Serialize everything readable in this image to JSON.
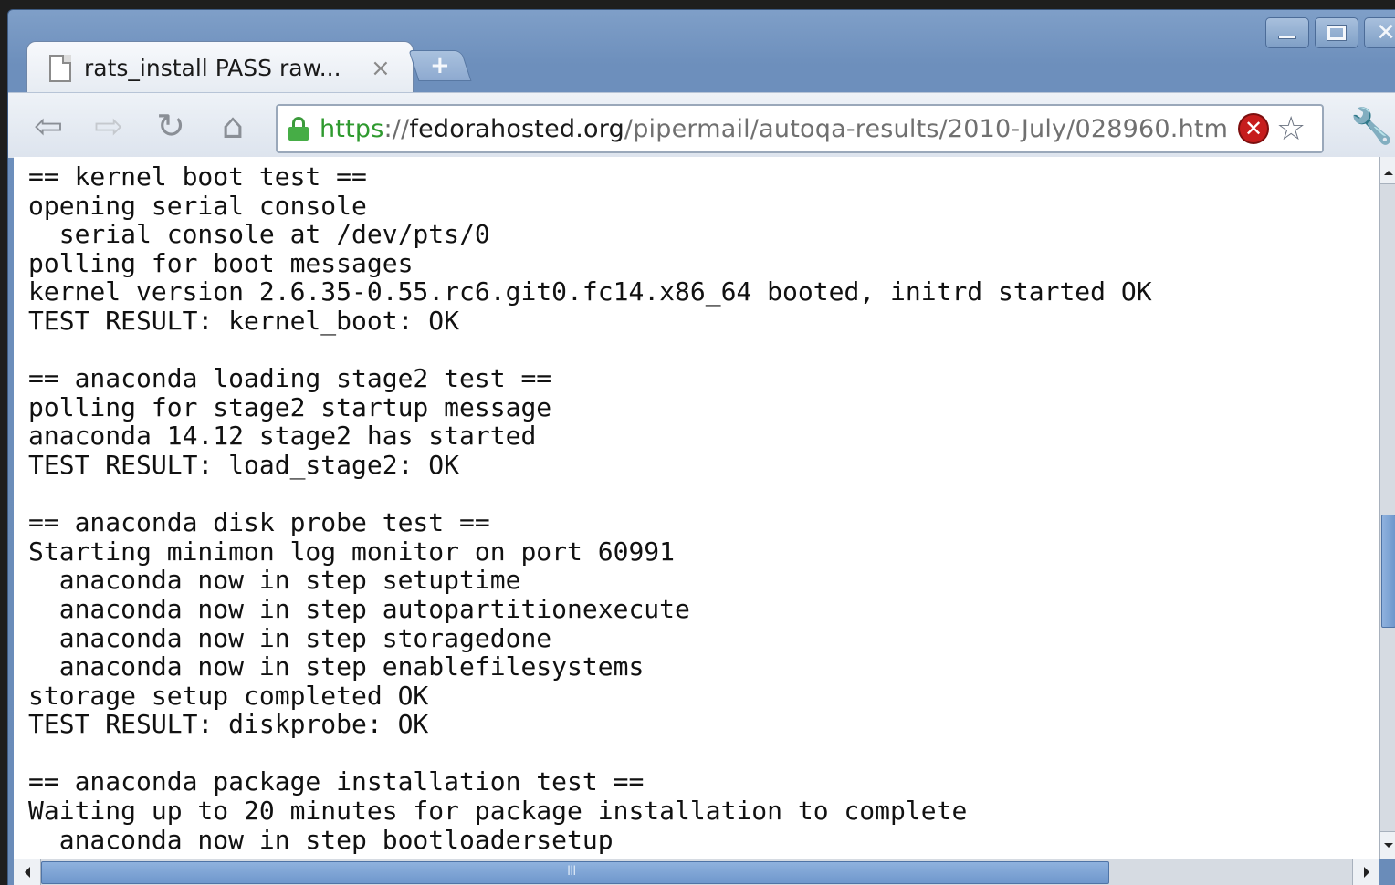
{
  "window": {
    "controls": [
      "minimize",
      "maximize",
      "close"
    ]
  },
  "tab": {
    "title": "rats_install PASS raw...",
    "close_glyph": "×",
    "new_tab_glyph": "+"
  },
  "toolbar": {
    "back_icon": "back-arrow-icon",
    "forward_icon": "forward-arrow-icon",
    "reload_icon": "reload-icon",
    "home_icon": "home-icon",
    "wrench_icon": "wrench-icon"
  },
  "omnibox": {
    "scheme": "https",
    "sep": "://",
    "host": "fedorahosted.org",
    "path": "/pipermail/autoqa-results/2010-July/028960.htm"
  },
  "content": {
    "lines": [
      "== kernel boot test ==",
      "opening serial console",
      "  serial console at /dev/pts/0",
      "polling for boot messages",
      "kernel version 2.6.35-0.55.rc6.git0.fc14.x86_64 booted, initrd started OK",
      "TEST RESULT: kernel_boot: OK",
      "",
      "== anaconda loading stage2 test ==",
      "polling for stage2 startup message",
      "anaconda 14.12 stage2 has started",
      "TEST RESULT: load_stage2: OK",
      "",
      "== anaconda disk probe test ==",
      "Starting minimon log monitor on port 60991",
      "  anaconda now in step setuptime",
      "  anaconda now in step autopartitionexecute",
      "  anaconda now in step storagedone",
      "  anaconda now in step enablefilesystems",
      "storage setup completed OK",
      "TEST RESULT: diskprobe: OK",
      "",
      "== anaconda package installation test ==",
      "Waiting up to 20 minutes for package installation to complete",
      "  anaconda now in step bootloadersetup"
    ]
  },
  "colors": {
    "titlebar": "#6d8fbc",
    "scheme_green": "#2f9a2f",
    "scroll_thumb": "#7fa4d5"
  }
}
